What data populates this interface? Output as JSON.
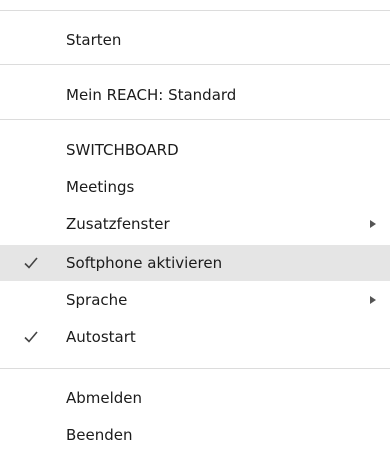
{
  "menu": {
    "items": [
      {
        "label": "Starten"
      },
      {
        "label": "Mein REACH: Standard"
      },
      {
        "label": "SWITCHBOARD"
      },
      {
        "label": "Meetings"
      },
      {
        "label": "Zusatzfenster",
        "submenu": true
      },
      {
        "label": "Softphone aktivieren",
        "checked": true,
        "highlighted": true
      },
      {
        "label": "Sprache",
        "submenu": true
      },
      {
        "label": "Autostart",
        "checked": true
      },
      {
        "label": "Abmelden"
      },
      {
        "label": "Beenden"
      }
    ],
    "check_icon": "checkmark-icon",
    "submenu_icon": "submenu-arrow-icon",
    "colors": {
      "background": "#ffffff",
      "highlight": "#e5e5e5",
      "separator": "#dcdcdc",
      "text": "#1b1b1b"
    }
  }
}
